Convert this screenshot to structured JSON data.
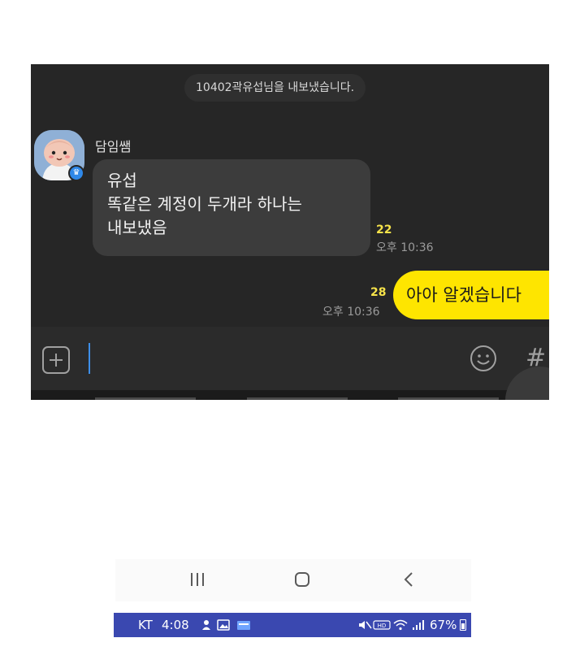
{
  "chat": {
    "system_notice": "10402곽유섭님을 내보냈습니다.",
    "incoming": {
      "sender": "담임쌤",
      "lines": [
        "유섭",
        "똑같은 계정이 두개라 하나는",
        "내보냈음"
      ],
      "unread_count": "22",
      "time": "오후 10:36"
    },
    "outgoing": {
      "text": "아아 알겠습니다",
      "unread_count": "28",
      "time": "오후 10:36"
    },
    "input": {
      "plus_icon": "plus-icon",
      "emoji_icon": "emoji-icon",
      "hash_label": "#"
    }
  },
  "navbar": {
    "recent_icon": "recent-apps-icon",
    "home_icon": "home-icon",
    "back_icon": "back-icon"
  },
  "statusbar": {
    "carrier": "KT",
    "time": "4:08",
    "battery": "67%",
    "colors": {
      "background": "#3a48b0"
    }
  },
  "colors": {
    "chat_background": "#262626",
    "incoming_bubble": "#3c3c3c",
    "outgoing_bubble": "#fee500",
    "unread_count": "#f7e34a"
  }
}
